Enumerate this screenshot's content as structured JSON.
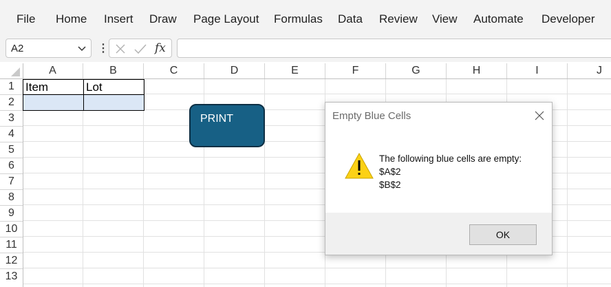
{
  "ribbon": {
    "tabs": [
      "File",
      "Home",
      "Insert",
      "Draw",
      "Page Layout",
      "Formulas",
      "Data",
      "Review",
      "View",
      "Automate",
      "Developer"
    ]
  },
  "formula_bar": {
    "name_box": "A2",
    "function_label": "fx",
    "formula": ""
  },
  "sheet": {
    "columns": [
      "A",
      "B",
      "C",
      "D",
      "E",
      "F",
      "G",
      "H",
      "I",
      "J"
    ],
    "rows": [
      "1",
      "2",
      "3",
      "4",
      "5",
      "6",
      "7",
      "8",
      "9",
      "10",
      "11",
      "12",
      "13"
    ],
    "cells": {
      "A1": "Item",
      "B1": "Lot",
      "A2": "",
      "B2": ""
    },
    "highlight_color": "#dbe7f6"
  },
  "shape": {
    "label": "PRINT",
    "fill": "#176085"
  },
  "dialog": {
    "title": "Empty Blue Cells",
    "message_line1": "The following blue cells are empty:",
    "message_line2": "$A$2",
    "message_line3": "$B$2",
    "ok_label": "OK",
    "icon": "warning-icon"
  }
}
